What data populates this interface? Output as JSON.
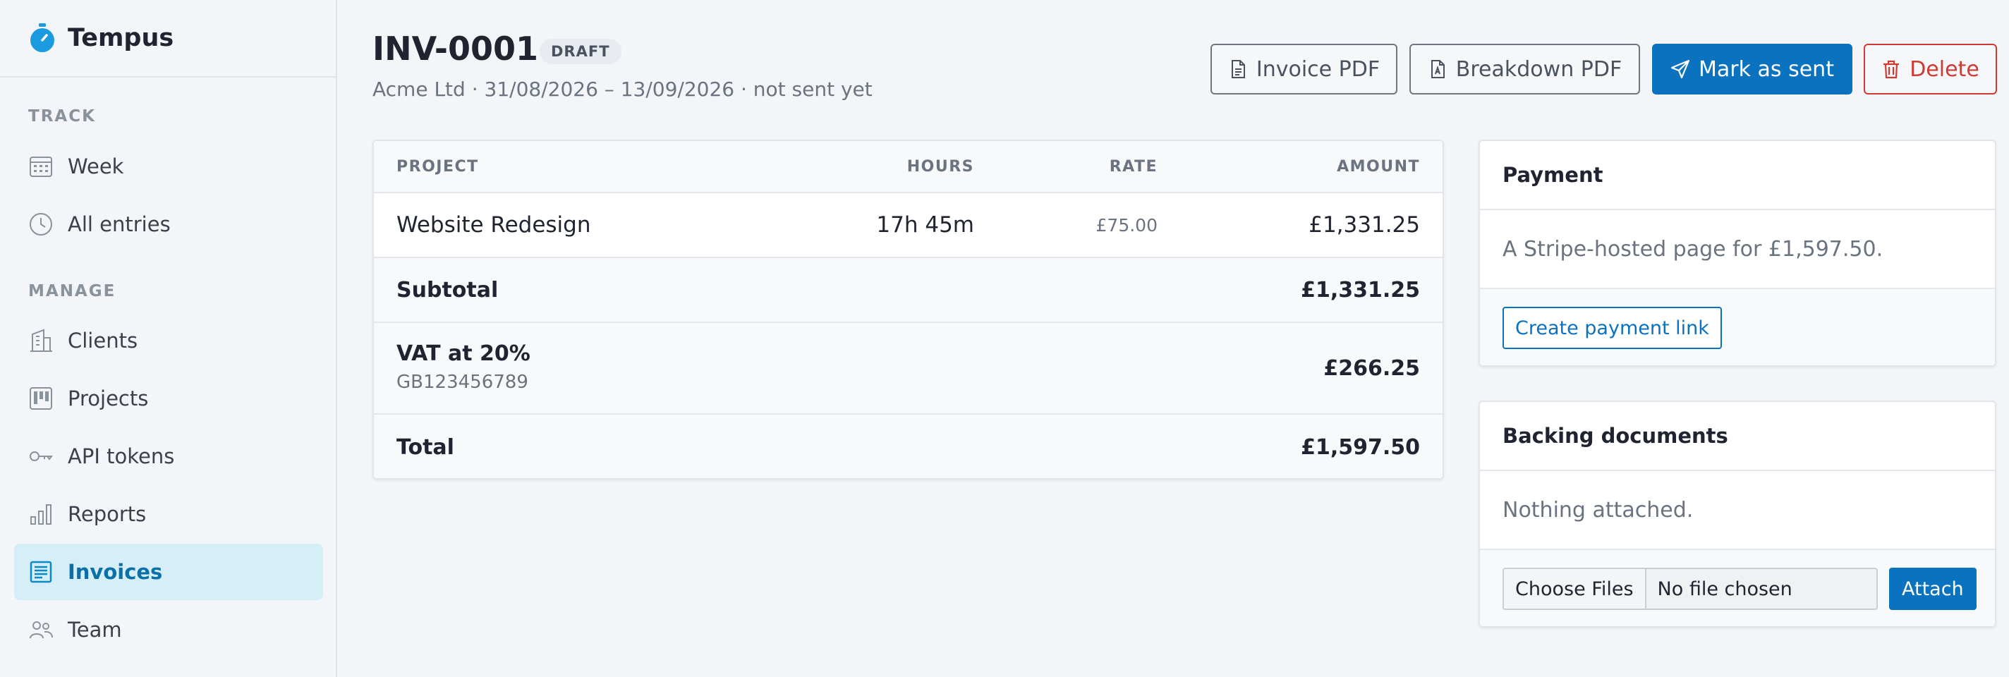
{
  "app": {
    "name": "Tempus"
  },
  "sidebar": {
    "sections": [
      {
        "label": "TRACK"
      },
      {
        "label": "MANAGE"
      }
    ],
    "items": [
      {
        "label": "Week",
        "icon": "calendar-icon"
      },
      {
        "label": "All entries",
        "icon": "clock-icon"
      },
      {
        "label": "Clients",
        "icon": "building-icon"
      },
      {
        "label": "Projects",
        "icon": "kanban-icon"
      },
      {
        "label": "API tokens",
        "icon": "key-icon"
      },
      {
        "label": "Reports",
        "icon": "bar-chart-icon"
      },
      {
        "label": "Invoices",
        "icon": "invoice-icon",
        "active": true
      },
      {
        "label": "Team",
        "icon": "people-icon"
      }
    ]
  },
  "invoice": {
    "number": "INV-0001",
    "status": "DRAFT",
    "subtitle": "Acme Ltd · 31/08/2026 – 13/09/2026 · not sent yet"
  },
  "actions": {
    "invoice_pdf": "Invoice PDF",
    "breakdown_pdf": "Breakdown PDF",
    "mark_sent": "Mark as sent",
    "delete": "Delete"
  },
  "table": {
    "headers": {
      "project": "PROJECT",
      "hours": "HOURS",
      "rate": "RATE",
      "amount": "AMOUNT"
    },
    "rows": [
      {
        "project": "Website Redesign",
        "hours": "17h 45m",
        "rate": "£75.00",
        "amount": "£1,331.25"
      }
    ],
    "subtotal": {
      "label": "Subtotal",
      "amount": "£1,331.25"
    },
    "vat": {
      "label": "VAT at 20%",
      "number": "GB123456789",
      "amount": "£266.25"
    },
    "total": {
      "label": "Total",
      "amount": "£1,597.50"
    }
  },
  "payment": {
    "title": "Payment",
    "description": "A Stripe-hosted page for £1,597.50.",
    "button": "Create payment link"
  },
  "backing": {
    "title": "Backing documents",
    "empty": "Nothing attached.",
    "choose_files": "Choose Files",
    "no_file": "No file chosen",
    "attach": "Attach"
  },
  "colors": {
    "accent": "#0b72c0",
    "danger": "#cf3a34",
    "active_nav_bg": "#d6eef8",
    "background": "#f3f5f8"
  }
}
